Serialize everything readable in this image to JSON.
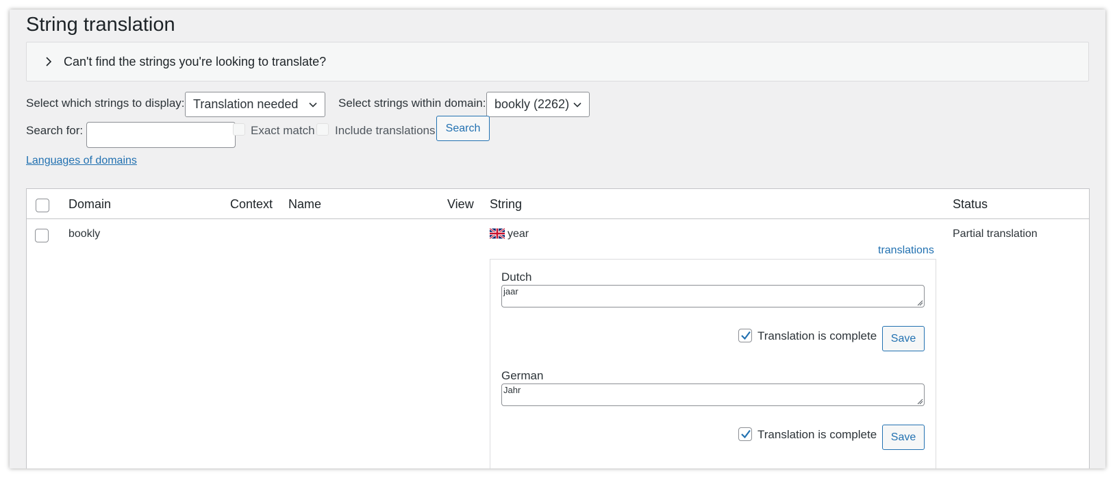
{
  "page": {
    "title": "String translation"
  },
  "notice": {
    "text": "Can't find the strings you're looking to translate?"
  },
  "filters": {
    "display_label": "Select which strings to display:",
    "display_value": "Translation needed",
    "domain_label": "Select strings within domain:",
    "domain_value": "bookly (2262)",
    "search_label": "Search for:",
    "search_value": "",
    "exact_match_label": "Exact match",
    "include_translations_label": "Include translations",
    "search_button": "Search"
  },
  "languages_link": "Languages of domains",
  "table": {
    "headers": {
      "domain": "Domain",
      "context": "Context",
      "name": "Name",
      "view": "View",
      "string": "String",
      "status": "Status"
    },
    "row": {
      "domain": "bookly",
      "string": "year",
      "translations_link": "translations",
      "status": "Partial translation",
      "translations": [
        {
          "language": "Dutch",
          "value": "jaar",
          "complete_label": "Translation is complete",
          "complete": true,
          "save_label": "Save"
        },
        {
          "language": "German",
          "value": "Jahr",
          "complete_label": "Translation is complete",
          "complete": true,
          "save_label": "Save"
        }
      ]
    }
  },
  "colors": {
    "accent": "#2271b1",
    "background": "#f0f0f1"
  }
}
